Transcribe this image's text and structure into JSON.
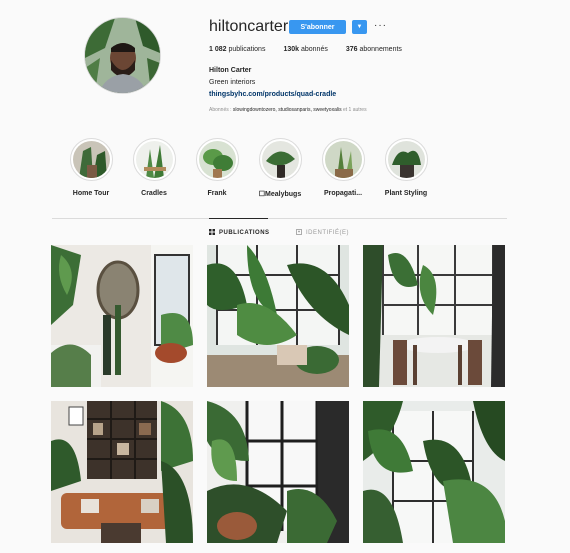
{
  "profile": {
    "username": "hiltoncarter",
    "follow_label": "S'abonner",
    "more_label": "···",
    "dropdown_icon": "chevron-down-icon",
    "stats": {
      "posts_value": "1 082",
      "posts_label": "publications",
      "followers_value": "130k",
      "followers_label": "abonnés",
      "following_value": "376",
      "following_label": "abonnements"
    },
    "full_name": "Hilton Carter",
    "bio": "Green interiors",
    "link": "thingsbyhc.com/products/quad-cradle",
    "followed_by_prefix": "Abonnés : ",
    "followed_by_names": "slowingdowntozero, studiosanparis, sweetyoxalis",
    "followed_by_suffix": " et 1 autres"
  },
  "highlights": [
    {
      "label": "Home Tour"
    },
    {
      "label": "Cradles"
    },
    {
      "label": "Frank"
    },
    {
      "label": "☐Mealybugs"
    },
    {
      "label": "Propagati..."
    },
    {
      "label": "Plant Styling"
    }
  ],
  "tabs": [
    {
      "label": "PUBLICATIONS",
      "icon": "grid-icon",
      "active": true
    },
    {
      "label": "IDENTIFIÉ(E)",
      "icon": "tag-icon",
      "active": false
    }
  ],
  "colors": {
    "accent": "#3897f0",
    "link": "#003569",
    "text": "#262626",
    "muted": "#8e8e8e",
    "background": "#fafafa"
  }
}
